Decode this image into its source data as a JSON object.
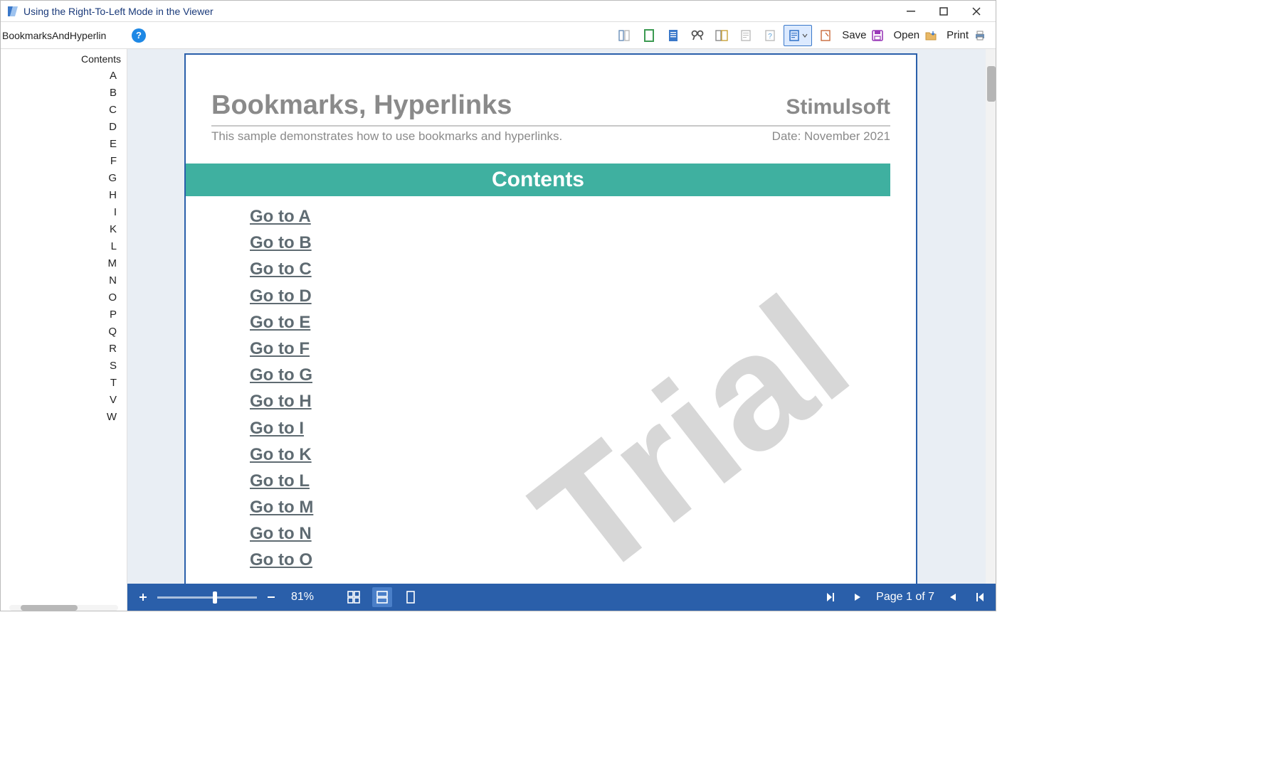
{
  "window": {
    "title": "Using the Right-To-Left Mode in the Viewer"
  },
  "toolbar": {
    "bookmark_root": "BookmarksAndHyperlin",
    "save_label": "Save",
    "open_label": "Open",
    "print_label": "Print"
  },
  "sidebar": {
    "contents_label": "Contents",
    "items": [
      "A",
      "B",
      "C",
      "D",
      "E",
      "F",
      "G",
      "H",
      "I",
      "K",
      "L",
      "M",
      "N",
      "O",
      "P",
      "Q",
      "R",
      "S",
      "T",
      "V",
      "W"
    ]
  },
  "report": {
    "title": "Bookmarks, Hyperlinks",
    "brand": "Stimulsoft",
    "subtitle": "This sample demonstrates how to use bookmarks and hyperlinks.",
    "date_label": "Date: November 2021",
    "contents_heading": "Contents",
    "links": [
      "Go to A",
      "Go to B",
      "Go to C",
      "Go to D",
      "Go to E",
      "Go to F",
      "Go to G",
      "Go to H",
      "Go to I",
      "Go to K",
      "Go to L",
      "Go to M",
      "Go to N",
      "Go to O"
    ],
    "watermark": "Trial"
  },
  "status": {
    "zoom_percent": "81%",
    "page_label": "Page 1 of 7"
  }
}
